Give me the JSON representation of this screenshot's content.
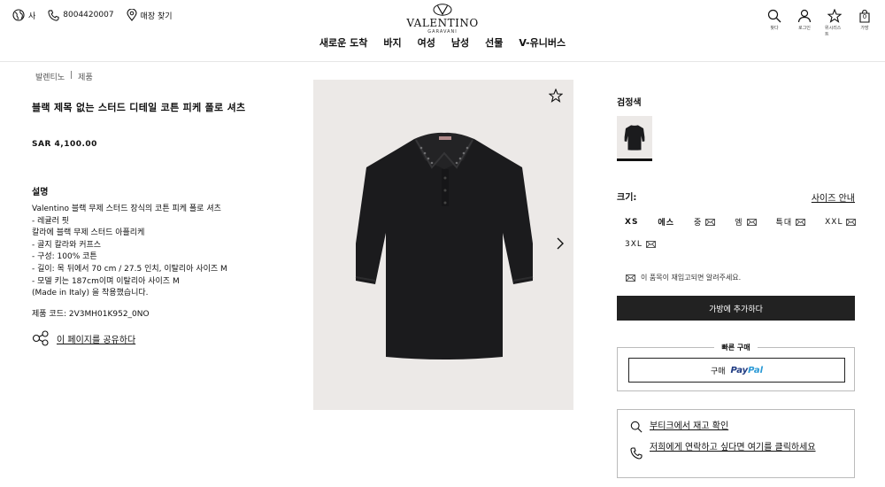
{
  "header": {
    "locale": "사",
    "phone": "8004420007",
    "store_finder": "매장 찾기",
    "logo_text": "VALENTINO",
    "logo_sub": "GARAVANI",
    "nav": [
      "새로운 도착",
      "바지",
      "여성",
      "남성",
      "선물",
      "V-유니버스"
    ],
    "icons": [
      {
        "icon": "search-icon",
        "label": "찾다"
      },
      {
        "icon": "user-icon",
        "label": "로그인"
      },
      {
        "icon": "star-icon",
        "label": "위시리스트"
      },
      {
        "icon": "bag-icon",
        "label": "가방",
        "count": "0"
      }
    ]
  },
  "breadcrumb": {
    "home": "발렌티노",
    "sep": "|",
    "current": "제품"
  },
  "product": {
    "title": "블랙 제목 없는 스터드 디테일 코튼 피케 폴로 셔츠",
    "price": "SAR 4,100.00",
    "description_heading": "설명",
    "description": [
      "Valentino 블랙 무제 스터드 장식의 코튼 피케 폴로 셔츠",
      "- 레귤러 핏",
      "칼라에 블랙 무제 스터드 아플리케",
      "- 골지 칼라와 커프스",
      "- 구성: 100% 코튼",
      "- 길이: 목 뒤에서 70 cm / 27.5 인치, 이탈리아 사이즈 M",
      "- 모델 키는 187cm이며 이탈리아 사이즈 M",
      "(Made in Italy) 을 착용했습니다."
    ],
    "code": "제품 코드: 2V3MH01K952_0NO",
    "share": "이 페이지를 공유하다"
  },
  "purchase": {
    "color_label": "검정색",
    "size_label": "크기:",
    "size_guide": "사이즈 안내",
    "sizes": [
      {
        "label": "XS",
        "available": true
      },
      {
        "label": "에스",
        "available": true
      },
      {
        "label": "중",
        "available": false
      },
      {
        "label": "엠",
        "available": false
      },
      {
        "label": "특대",
        "available": false
      },
      {
        "label": "XXL",
        "available": false
      },
      {
        "label": "3XL",
        "available": false
      }
    ],
    "notify": "이 품목이 재입고되면 알려주세요.",
    "add_to_bag": "가방에 추가하다",
    "quick_buy": "빠른 구매",
    "buy_with": "구매",
    "paypal_a": "Pay",
    "paypal_b": "Pal",
    "stock_check": "부티크에서 재고 확인",
    "contact": "저희에게 연락하고 싶다면 여기를 클릭하세요"
  },
  "colors": {
    "accent": "#111111",
    "button": "#222222",
    "image_bg": "#ece9e7",
    "paypal_dark": "#1f3b82",
    "paypal_light": "#2b9ad6"
  }
}
